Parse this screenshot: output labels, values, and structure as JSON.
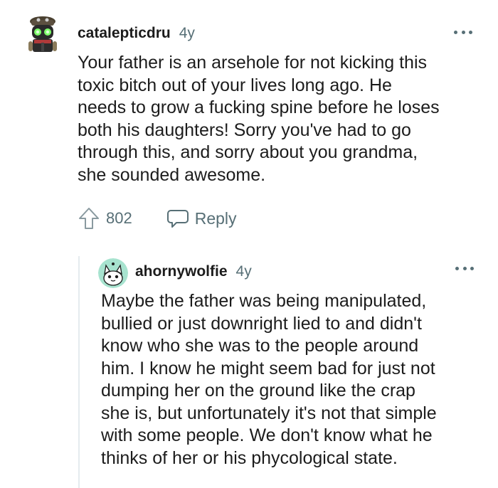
{
  "comments": [
    {
      "username": "catalepticdru",
      "age": "4y",
      "body_lines": [
        "Your father is an arsehole for not kicking this",
        "toxic bitch out of your lives long ago. He",
        "needs to grow a fucking spine before he loses",
        "both his daughters! Sorry you've had to go",
        "through this, and sorry about you grandma,",
        "she sounded awesome."
      ],
      "upvotes": "802",
      "reply_label": "Reply"
    },
    {
      "username": "ahornywolfie",
      "age": "4y",
      "body_lines": [
        "Maybe the father was being manipulated,",
        "bullied or just downright lied to and didn't",
        "know who she was to the people around",
        "him. I know he might seem bad for just not",
        "dumping her on the ground like the crap",
        "she is, but unfortunately it's not that simple",
        "with some people. We don't know what he",
        "thinks of her or his phycological state."
      ]
    }
  ],
  "icons": {
    "upvote": "arrow-up-icon",
    "reply": "speech-bubble-icon",
    "more": "more-options-icon"
  },
  "colors": {
    "meta_text": "#576f76",
    "body_text": "#1c1c1c",
    "thread_line": "#e5ebee",
    "avatar2_bg": "#a7e3cf"
  }
}
